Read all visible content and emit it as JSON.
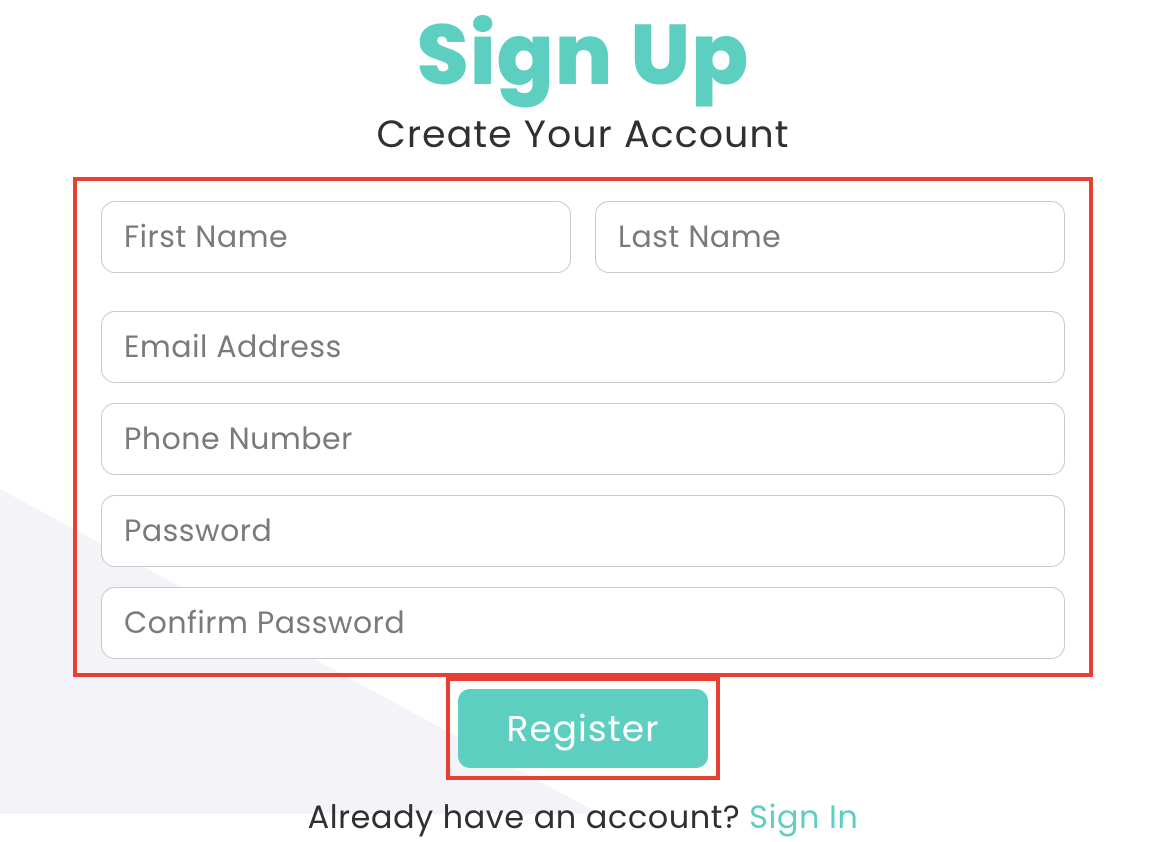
{
  "header": {
    "title": "Sign Up",
    "subtitle": "Create Your Account"
  },
  "form": {
    "first_name": {
      "placeholder": "First Name",
      "value": ""
    },
    "last_name": {
      "placeholder": "Last Name",
      "value": ""
    },
    "email": {
      "placeholder": "Email Address",
      "value": ""
    },
    "phone": {
      "placeholder": "Phone Number",
      "value": ""
    },
    "password": {
      "placeholder": "Password",
      "value": ""
    },
    "confirm_password": {
      "placeholder": "Confirm Password",
      "value": ""
    }
  },
  "actions": {
    "register_label": "Register"
  },
  "footer": {
    "prompt": "Already have an account? ",
    "signin_label": "Sign In"
  },
  "colors": {
    "accent": "#5ccfc1",
    "highlight_border": "#e93f33"
  }
}
